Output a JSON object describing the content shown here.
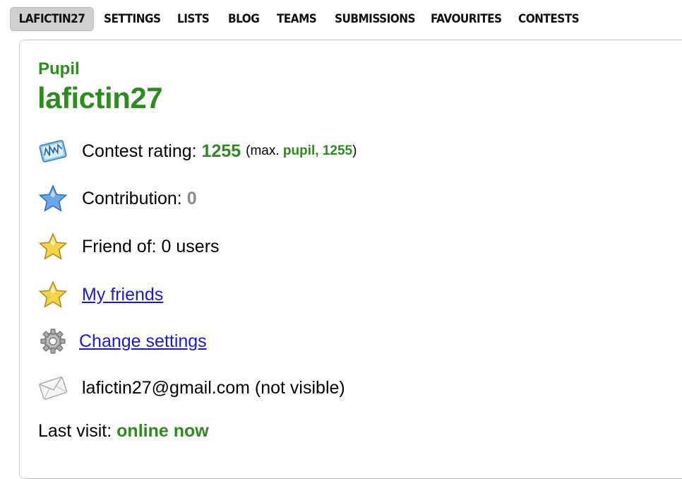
{
  "nav": {
    "items": [
      "LAFICTIN27",
      "SETTINGS",
      "LISTS",
      "BLOG",
      "TEAMS",
      "SUBMISSIONS",
      "FAVOURITES",
      "CONTESTS"
    ],
    "active": "LAFICTIN27"
  },
  "profile": {
    "rank": "Pupil",
    "handle": "lafictin27",
    "rating_label": "Contest rating:",
    "rating_value": "1255",
    "max_open": "(max.",
    "max_rank_value": "pupil, 1255",
    "max_close": ")",
    "contribution_label": "Contribution:",
    "contribution_value": "0",
    "friend_of": "Friend of: 0 users",
    "my_friends": "My friends",
    "change_settings": "Change settings",
    "email": "lafictin27@gmail.com (not visible)",
    "last_visit_label": "Last visit:",
    "last_visit_value": "online now"
  },
  "colors": {
    "rank_green": "#2e8b1f",
    "link_blue": "#1a1ad6",
    "active_tab_bg": "#cfcfcf"
  },
  "icons": [
    "rating-chart-icon",
    "blue-star-icon",
    "gold-star-icon",
    "gold-star-icon",
    "gear-icon",
    "envelope-icon"
  ]
}
